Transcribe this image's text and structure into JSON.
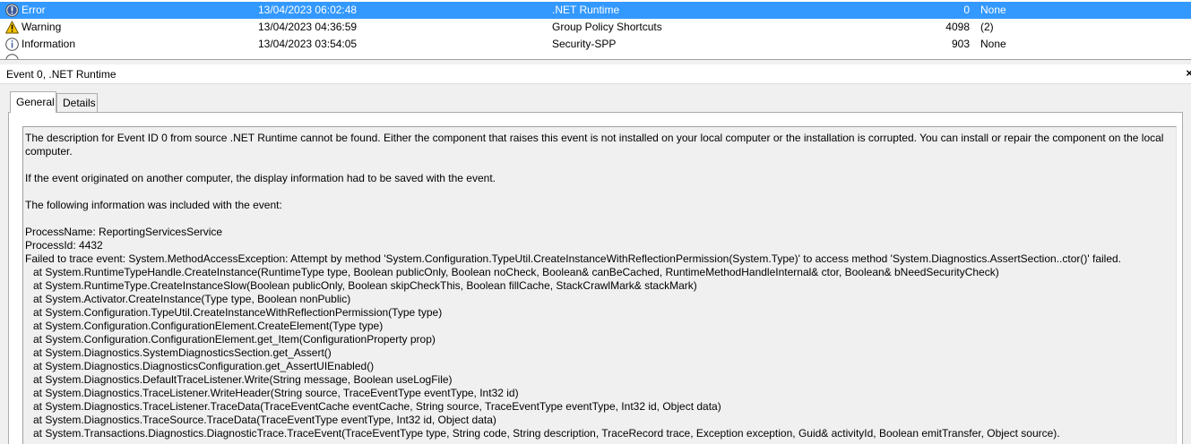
{
  "event_list": {
    "rows": [
      {
        "level": "Error",
        "icon": "error-icon",
        "date": "13/04/2023 06:02:48",
        "source": ".NET Runtime",
        "event_id": "0",
        "category": "None",
        "selected": true
      },
      {
        "level": "Warning",
        "icon": "warning-icon",
        "date": "13/04/2023 04:36:59",
        "source": "Group Policy Shortcuts",
        "event_id": "4098",
        "category": "(2)",
        "selected": false
      },
      {
        "level": "Information",
        "icon": "information-icon",
        "date": "13/04/2023 03:54:05",
        "source": "Security-SPP",
        "event_id": "903",
        "category": "None",
        "selected": false
      }
    ]
  },
  "details_pane": {
    "title": "Event 0, .NET Runtime",
    "close_glyph": "×",
    "tabs": [
      {
        "label": "General",
        "active": true
      },
      {
        "label": "Details",
        "active": false
      }
    ],
    "description": {
      "para1": "The description for Event ID 0 from source .NET Runtime cannot be found. Either the component that raises this event is not installed on your local computer or the installation is corrupted. You can install or repair the component on the local computer.",
      "para2": "If the event originated on another computer, the display information had to be saved with the event.",
      "para3": "The following information was included with the event:",
      "process_name": "ProcessName: ReportingServicesService",
      "process_id": "ProcessId: 4432",
      "failure": "Failed to trace event: System.MethodAccessException: Attempt by method 'System.Configuration.TypeUtil.CreateInstanceWithReflectionPermission(System.Type)' to access method 'System.Diagnostics.AssertSection..ctor()' failed.",
      "stack": [
        "at System.RuntimeTypeHandle.CreateInstance(RuntimeType type, Boolean publicOnly, Boolean noCheck, Boolean& canBeCached, RuntimeMethodHandleInternal& ctor, Boolean& bNeedSecurityCheck)",
        "at System.RuntimeType.CreateInstanceSlow(Boolean publicOnly, Boolean skipCheckThis, Boolean fillCache, StackCrawlMark& stackMark)",
        "at System.Activator.CreateInstance(Type type, Boolean nonPublic)",
        "at System.Configuration.TypeUtil.CreateInstanceWithReflectionPermission(Type type)",
        "at System.Configuration.ConfigurationElement.CreateElement(Type type)",
        "at System.Configuration.ConfigurationElement.get_Item(ConfigurationProperty prop)",
        "at System.Diagnostics.SystemDiagnosticsSection.get_Assert()",
        "at System.Diagnostics.DiagnosticsConfiguration.get_AssertUIEnabled()",
        "at System.Diagnostics.DefaultTraceListener.Write(String message, Boolean useLogFile)",
        "at System.Diagnostics.TraceListener.WriteHeader(String source, TraceEventType eventType, Int32 id)",
        "at System.Diagnostics.TraceListener.TraceData(TraceEventCache eventCache, String source, TraceEventType eventType, Int32 id, Object data)",
        "at System.Diagnostics.TraceSource.TraceData(TraceEventType eventType, Int32 id, Object data)",
        "at System.Transactions.Diagnostics.DiagnosticTrace.TraceEvent(TraceEventType type, String code, String description, TraceRecord trace, Exception exception, Guid& activityId, Boolean emitTransfer, Object source)."
      ]
    }
  },
  "colors": {
    "selection": "#3399ff",
    "error_icon": "#3b5998",
    "warning_icon": "#f2c200",
    "pane_background": "#f0f0f0"
  }
}
